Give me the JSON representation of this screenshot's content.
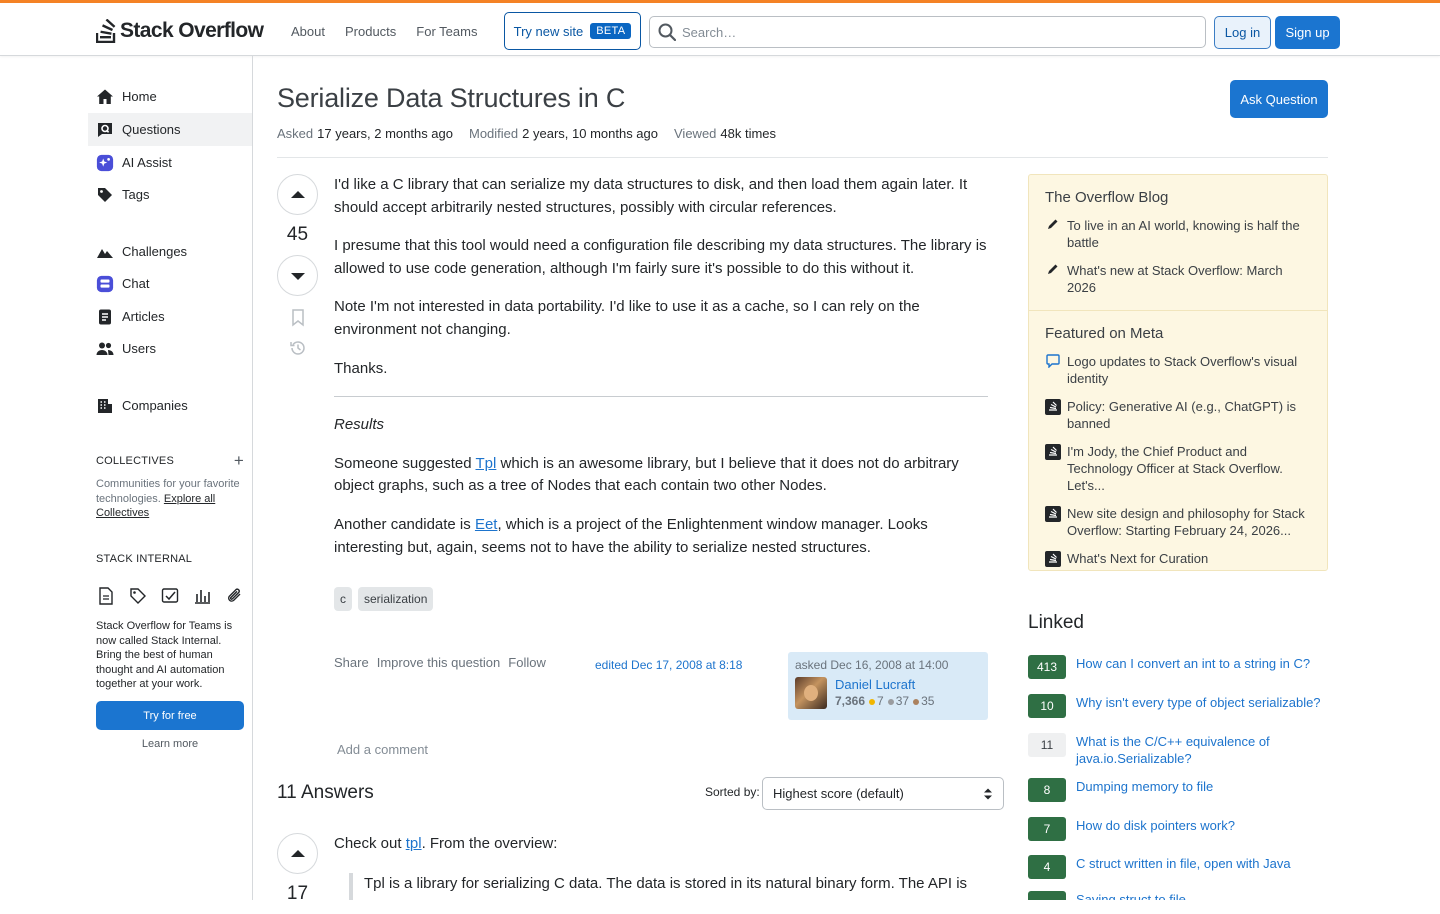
{
  "header": {
    "logo_text": "Stack Overflow",
    "nav": [
      "About",
      "Products",
      "For Teams"
    ],
    "try_new_site": "Try new site",
    "beta": "BETA",
    "search_placeholder": "Search…",
    "login": "Log in",
    "signup": "Sign up"
  },
  "sidebar": {
    "items": [
      {
        "label": "Home",
        "icon": "home-icon"
      },
      {
        "label": "Questions",
        "icon": "questions-icon"
      },
      {
        "label": "AI Assist",
        "icon": "ai-assist-icon"
      },
      {
        "label": "Tags",
        "icon": "tag-icon"
      },
      {
        "label": "Challenges",
        "icon": "challenges-icon"
      },
      {
        "label": "Chat",
        "icon": "chat-icon"
      },
      {
        "label": "Articles",
        "icon": "articles-icon"
      },
      {
        "label": "Users",
        "icon": "users-icon"
      },
      {
        "label": "Companies",
        "icon": "companies-icon"
      }
    ],
    "collectives_heading": "COLLECTIVES",
    "collectives_text": "Communities for your favorite technologies.",
    "collectives_link": "Explore all Collectives",
    "stack_internal_heading": "STACK INTERNAL",
    "stack_internal_text": "Stack Overflow for Teams is now called Stack Internal. Bring the best of human thought and AI automation together at your work.",
    "try_free": "Try for free",
    "learn_more": "Learn more"
  },
  "question": {
    "title": "Serialize Data Structures in C",
    "asked_label": "Asked",
    "asked_value": "17 years, 2 months ago",
    "modified_label": "Modified",
    "modified_value": "2 years, 10 months ago",
    "viewed_label": "Viewed",
    "viewed_value": "48k times",
    "ask_button": "Ask Question",
    "score": "45",
    "p1": "I'd like a C library that can serialize my data structures to disk, and then load them again later. It should accept arbitrarily nested structures, possibly with circular references.",
    "p2": "I presume that this tool would need a configuration file describing my data structures. The library is allowed to use code generation, although I'm fairly sure it's possible to do this without it.",
    "p3": "Note I'm not interested in data portability. I'd like to use it as a cache, so I can rely on the environment not changing.",
    "p4": "Thanks.",
    "results_heading": "Results",
    "p5_a": "Someone suggested ",
    "p5_link": "Tpl",
    "p5_b": " which is an awesome library, but I believe that it does not do arbitrary object graphs, such as a tree of Nodes that each contain two other Nodes.",
    "p6_a": "Another candidate is ",
    "p6_link": "Eet",
    "p6_b": ", which is a project of the Enlightenment window manager. Looks interesting but, again, seems not to have the ability to serialize nested structures.",
    "tags": [
      "c",
      "serialization"
    ],
    "actions": [
      "Share",
      "Improve this question",
      "Follow"
    ],
    "edited": "edited Dec 17, 2008 at 8:18",
    "asked_card": "asked Dec 16, 2008 at 14:00",
    "user_name": "Daniel Lucraft",
    "user_rep": "7,366",
    "badge_gold": "7",
    "badge_silver": "37",
    "badge_bronze": "35",
    "add_comment": "Add a comment"
  },
  "answers": {
    "count_label": "11 Answers",
    "sorted_by": "Sorted by:",
    "sort_value": "Highest score (default)",
    "first_score": "17",
    "first_a": "Check out ",
    "first_link": "tpl",
    "first_b": ". From the overview:",
    "first_quote": "Tpl is a library for serializing C data. The data is stored in its natural binary form. The API is"
  },
  "right": {
    "blog_heading": "The Overflow Blog",
    "blog_items": [
      "To live in an AI world, knowing is half the battle",
      "What's new at Stack Overflow: March 2026"
    ],
    "meta_heading": "Featured on Meta",
    "meta_items": [
      "Logo updates to Stack Overflow's visual identity",
      "Policy: Generative AI (e.g., ChatGPT) is banned",
      "I'm Jody, the Chief Product and Technology Officer at Stack Overflow. Let's...",
      "New site design and philosophy for Stack Overflow: Starting February 24, 2026...",
      "What's Next for Curation"
    ],
    "linked_heading": "Linked",
    "linked": [
      {
        "count": "413",
        "title": "How can I convert an int to a string in C?"
      },
      {
        "count": "10",
        "title": "Why isn't every type of object serializable?"
      },
      {
        "count": "11",
        "title": "What is the C/C++ equivalence of java.io.Serializable?"
      },
      {
        "count": "8",
        "title": "Dumping memory to file"
      },
      {
        "count": "7",
        "title": "How do disk pointers work?"
      },
      {
        "count": "4",
        "title": "C struct written in file, open with Java"
      },
      {
        "count": "",
        "title": "Saving struct to file"
      }
    ]
  },
  "colors": {
    "accent": "#f48225",
    "primary": "#1b75d0",
    "link": "#1d74cd",
    "accepted": "#2f6f44"
  }
}
